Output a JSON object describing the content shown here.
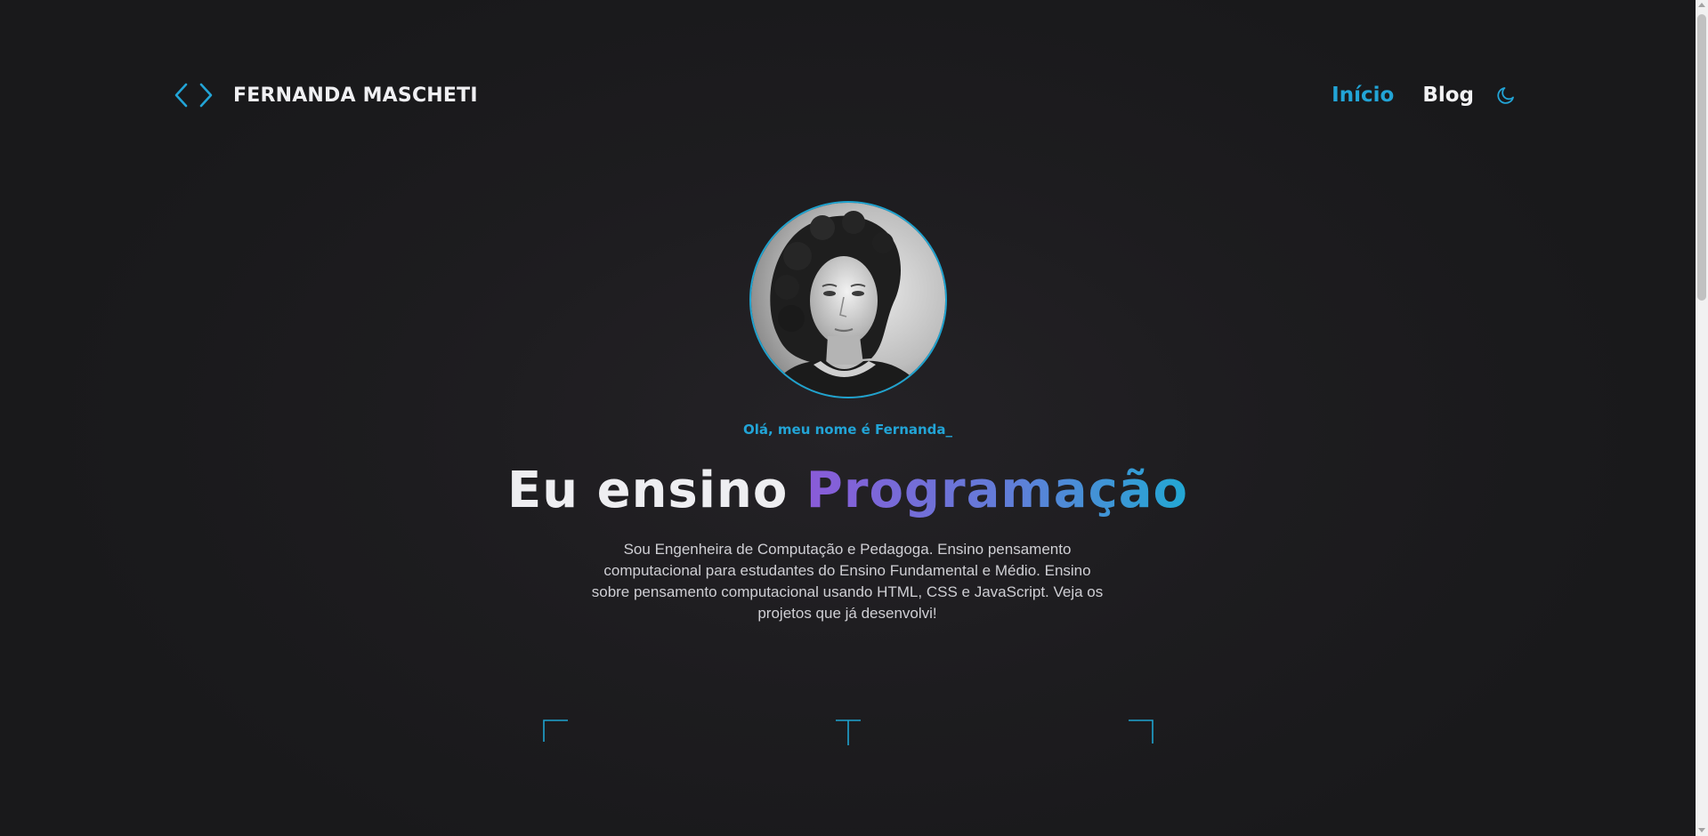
{
  "header": {
    "brand_name": "FERNANDA MASCHETI",
    "nav": [
      {
        "label": "Início",
        "active": true
      },
      {
        "label": "Blog",
        "active": false
      }
    ],
    "theme_toggle_icon": "moon-icon"
  },
  "hero": {
    "avatar_icon": "profile-photo",
    "greeting": "Olá, meu nome é Fernanda_",
    "headline_prefix": "Eu ensino ",
    "headline_highlight": "Programação",
    "description": "Sou Engenheira de Computação e Pedagoga. Ensino pensamento computacional para estudantes do Ensino Fundamental e Médio. Ensino sobre pensamento computacional usando HTML, CSS e JavaScript. Veja os projetos que já desenvolvi!"
  },
  "colors": {
    "accent": "#22a4d6",
    "gradient_start": "#8a5bd8",
    "gradient_end": "#22a8d4",
    "background": "#1d1c1f",
    "text": "#ececf0"
  }
}
